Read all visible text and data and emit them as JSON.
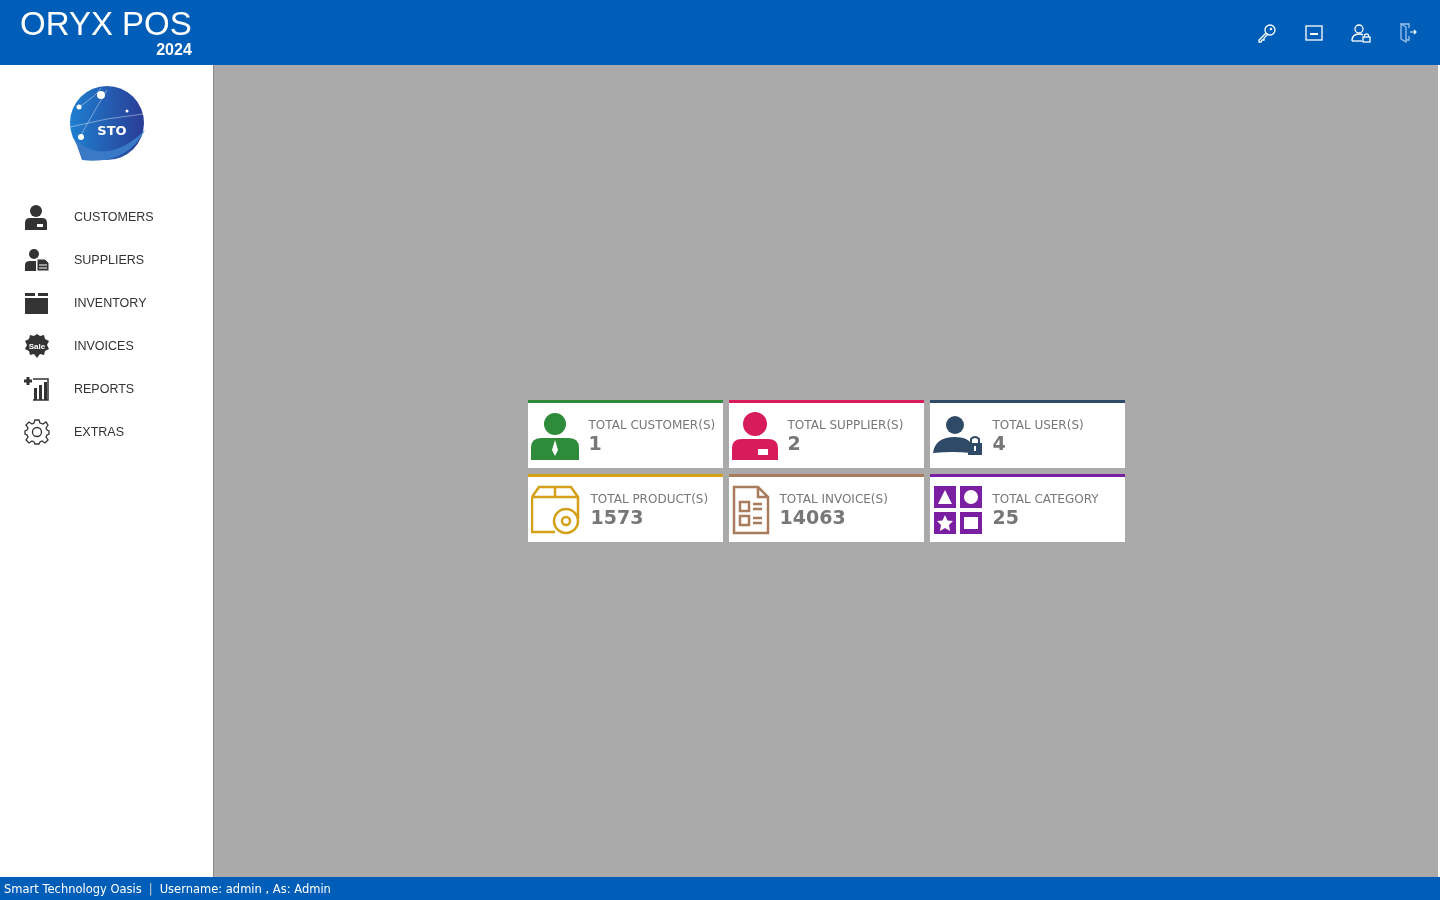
{
  "header": {
    "title": "ORYX POS",
    "year": "2024"
  },
  "logo": {
    "text": "STO"
  },
  "sidebar": {
    "items": [
      {
        "label": "CUSTOMERS"
      },
      {
        "label": "SUPPLIERS"
      },
      {
        "label": "INVENTORY"
      },
      {
        "label": "INVOICES",
        "badge": "Sale"
      },
      {
        "label": "REPORTS"
      },
      {
        "label": "EXTRAS"
      }
    ]
  },
  "cards": [
    {
      "kind": "customer",
      "label": "TOTAL CUSTOMER(S)",
      "value": "1",
      "color": "#2e8b3a"
    },
    {
      "kind": "supplier",
      "label": "TOTAL SUPPLIER(S)",
      "value": "2",
      "color": "#d81b5a"
    },
    {
      "kind": "user",
      "label": "TOTAL USER(S)",
      "value": "4",
      "color": "#2f4a66"
    },
    {
      "kind": "product",
      "label": "TOTAL PRODUCT(S)",
      "value": "1573",
      "color": "#d4a017"
    },
    {
      "kind": "invoice",
      "label": "TOTAL INVOICE(S)",
      "value": "14063",
      "color": "#a87c5c"
    },
    {
      "kind": "category",
      "label": "TOTAL CATEGORY",
      "value": "25",
      "color": "#7b1fa2"
    }
  ],
  "status_bar": {
    "company": "Smart Technology Oasis",
    "separator": "|",
    "user": "Username: admin , As: Admin"
  }
}
